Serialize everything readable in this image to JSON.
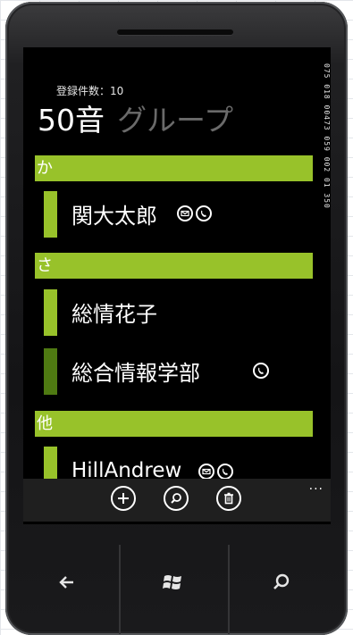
{
  "status": {
    "text": "075 018 00473 059 002 01 350"
  },
  "header": {
    "record_count": "登録件数：10"
  },
  "pivot": {
    "tabs": [
      {
        "label": "50音"
      },
      {
        "label": "グループ"
      }
    ]
  },
  "groups": [
    {
      "header": "か",
      "contacts": [
        {
          "name": "関大太郎",
          "has_mail": true,
          "has_phone": true
        }
      ]
    },
    {
      "header": "さ",
      "contacts": [
        {
          "name": "総情花子"
        },
        {
          "name": "総合情報学部",
          "has_phone": true
        }
      ]
    },
    {
      "header": "他",
      "contacts": [
        {
          "name": "HillAndrew",
          "has_mail": true,
          "has_phone": true
        }
      ]
    }
  ],
  "appbar": {
    "more": "..."
  },
  "icons": {
    "mail": "mail-icon",
    "phone": "phone-icon",
    "add": "add-icon",
    "search": "search-icon",
    "delete": "delete-icon",
    "back": "back-arrow-icon",
    "start": "windows-logo-icon",
    "hw_search": "search-icon"
  },
  "colors": {
    "accent": "#98c22a",
    "accent_dark": "#4f7a12",
    "background": "#000000"
  }
}
